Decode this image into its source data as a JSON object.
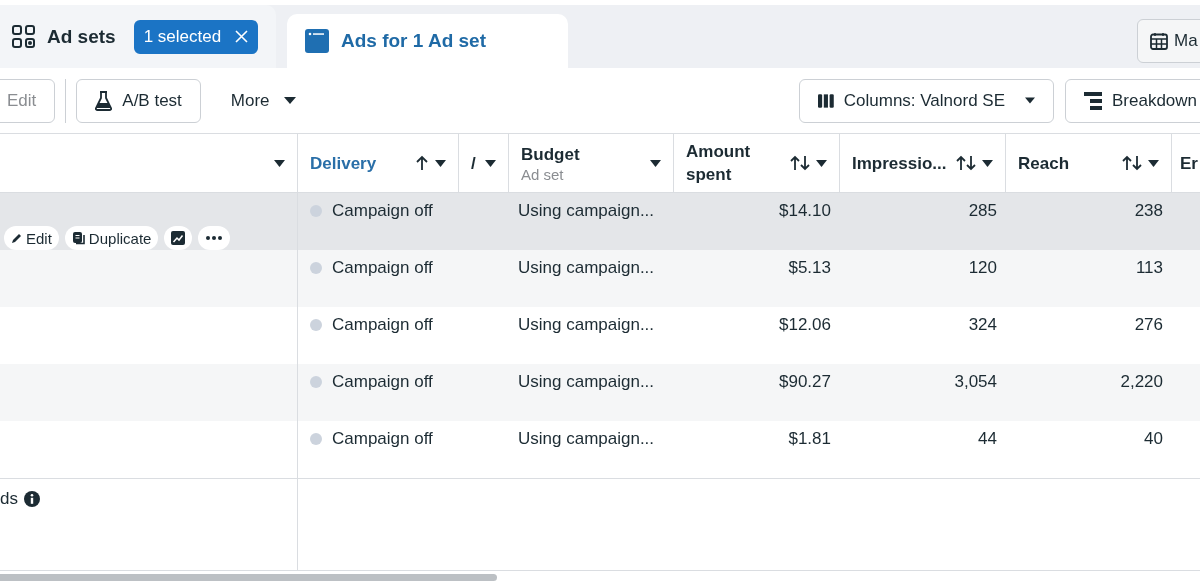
{
  "tabs": [
    {
      "label": "Ad sets",
      "selected": false,
      "badge": "1 selected"
    },
    {
      "label": "Ads for 1 Ad set",
      "selected": true
    }
  ],
  "date_button": {
    "label": "Ma"
  },
  "toolbar": {
    "edit": {
      "label": "Edit",
      "disabled": true
    },
    "ab_test": {
      "label": "A/B test"
    },
    "more": {
      "label": "More"
    },
    "columns": {
      "label": "Columns: Valnord SE"
    },
    "breakdown": {
      "label": "Breakdown"
    }
  },
  "table": {
    "columns": [
      {
        "sorted": false,
        "sortable": false
      },
      {
        "label": "Delivery",
        "sorted": true,
        "active": true
      },
      {
        "label": "/",
        "sorted": false,
        "sortable": false,
        "active": false
      },
      {
        "label": "Budget",
        "sublabel": "Ad set",
        "sorted": false,
        "sortable": false,
        "active": false
      },
      {
        "label": "Amount spent",
        "sorted": false,
        "sortable": true,
        "active": false
      },
      {
        "label": "Impressio...",
        "sorted": false,
        "sortable": true,
        "active": false
      },
      {
        "label": "Reach",
        "sorted": false,
        "sortable": true,
        "active": false
      },
      {
        "label": "Er",
        "active": false
      }
    ],
    "rows": [
      {
        "selected": true,
        "delivery": "Campaign off",
        "budget": "Using campaign...",
        "amount_spent": "$14.10",
        "impressions": "285",
        "reach": "238",
        "actions": [
          {
            "kind": "edit",
            "label": "Edit"
          },
          {
            "kind": "duplicate",
            "label": "Duplicate"
          },
          {
            "kind": "chart"
          },
          {
            "kind": "more"
          }
        ]
      },
      {
        "selected": false,
        "delivery": "Campaign off",
        "budget": "Using campaign...",
        "amount_spent": "$5.13",
        "impressions": "120",
        "reach": "113"
      },
      {
        "selected": false,
        "delivery": "Campaign off",
        "budget": "Using campaign...",
        "amount_spent": "$12.06",
        "impressions": "324",
        "reach": "276"
      },
      {
        "selected": false,
        "delivery": "Campaign off",
        "budget": "Using campaign...",
        "amount_spent": "$90.27",
        "impressions": "3,054",
        "reach": "2,220"
      },
      {
        "selected": false,
        "delivery": "Campaign off",
        "budget": "Using campaign...",
        "amount_spent": "$1.81",
        "impressions": "44",
        "reach": "40"
      }
    ],
    "footer": {
      "label": "ds"
    }
  }
}
